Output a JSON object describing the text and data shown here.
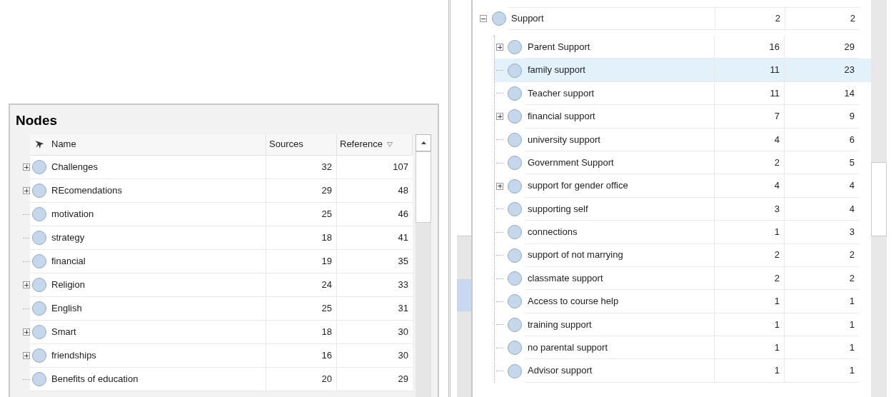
{
  "left_panel": {
    "title": "Nodes",
    "columns": [
      {
        "label": "Name",
        "sorted": false
      },
      {
        "label": "Sources",
        "sorted": false
      },
      {
        "label": "Reference",
        "sorted": true
      }
    ],
    "rows": [
      {
        "name": "Challenges",
        "sources": "32",
        "references": "107",
        "expandable": true
      },
      {
        "name": "REcomendations",
        "sources": "29",
        "references": "48",
        "expandable": true
      },
      {
        "name": "motivation",
        "sources": "25",
        "references": "46",
        "expandable": false
      },
      {
        "name": "strategy",
        "sources": "18",
        "references": "41",
        "expandable": false
      },
      {
        "name": "financial",
        "sources": "19",
        "references": "35",
        "expandable": false
      },
      {
        "name": "Religion",
        "sources": "24",
        "references": "33",
        "expandable": true
      },
      {
        "name": "English",
        "sources": "25",
        "references": "31",
        "expandable": false
      },
      {
        "name": "Smart",
        "sources": "18",
        "references": "30",
        "expandable": true
      },
      {
        "name": "friendships",
        "sources": "16",
        "references": "30",
        "expandable": true
      },
      {
        "name": "Benefits of education",
        "sources": "20",
        "references": "29",
        "expandable": false
      }
    ]
  },
  "right_panel": {
    "rows": [
      {
        "name": "Support",
        "sources": "2",
        "references": "2",
        "expandable": true,
        "expanded": true,
        "selected": false,
        "children": [
          {
            "name": "Parent Support",
            "sources": "16",
            "references": "29",
            "expandable": true,
            "selected": false
          },
          {
            "name": "family support",
            "sources": "11",
            "references": "23",
            "expandable": false,
            "selected": true
          },
          {
            "name": "Teacher support",
            "sources": "11",
            "references": "14",
            "expandable": false,
            "selected": false
          },
          {
            "name": "financial support",
            "sources": "7",
            "references": "9",
            "expandable": true,
            "selected": false
          },
          {
            "name": "university support",
            "sources": "4",
            "references": "6",
            "expandable": false,
            "selected": false
          },
          {
            "name": "Government Support",
            "sources": "2",
            "references": "5",
            "expandable": false,
            "selected": false
          },
          {
            "name": "support for gender office",
            "sources": "4",
            "references": "4",
            "expandable": true,
            "selected": false
          },
          {
            "name": "supporting self",
            "sources": "3",
            "references": "4",
            "expandable": false,
            "selected": false
          },
          {
            "name": "connections",
            "sources": "1",
            "references": "3",
            "expandable": false,
            "selected": false
          },
          {
            "name": "support of not marrying",
            "sources": "2",
            "references": "2",
            "expandable": false,
            "selected": false
          },
          {
            "name": "classmate support",
            "sources": "2",
            "references": "2",
            "expandable": false,
            "selected": false
          },
          {
            "name": "Access to course help",
            "sources": "1",
            "references": "1",
            "expandable": false,
            "selected": false
          },
          {
            "name": "training support",
            "sources": "1",
            "references": "1",
            "expandable": false,
            "selected": false
          },
          {
            "name": "no parental support",
            "sources": "1",
            "references": "1",
            "expandable": false,
            "selected": false
          },
          {
            "name": "Advisor support",
            "sources": "1",
            "references": "1",
            "expandable": false,
            "selected": false
          }
        ]
      }
    ]
  }
}
